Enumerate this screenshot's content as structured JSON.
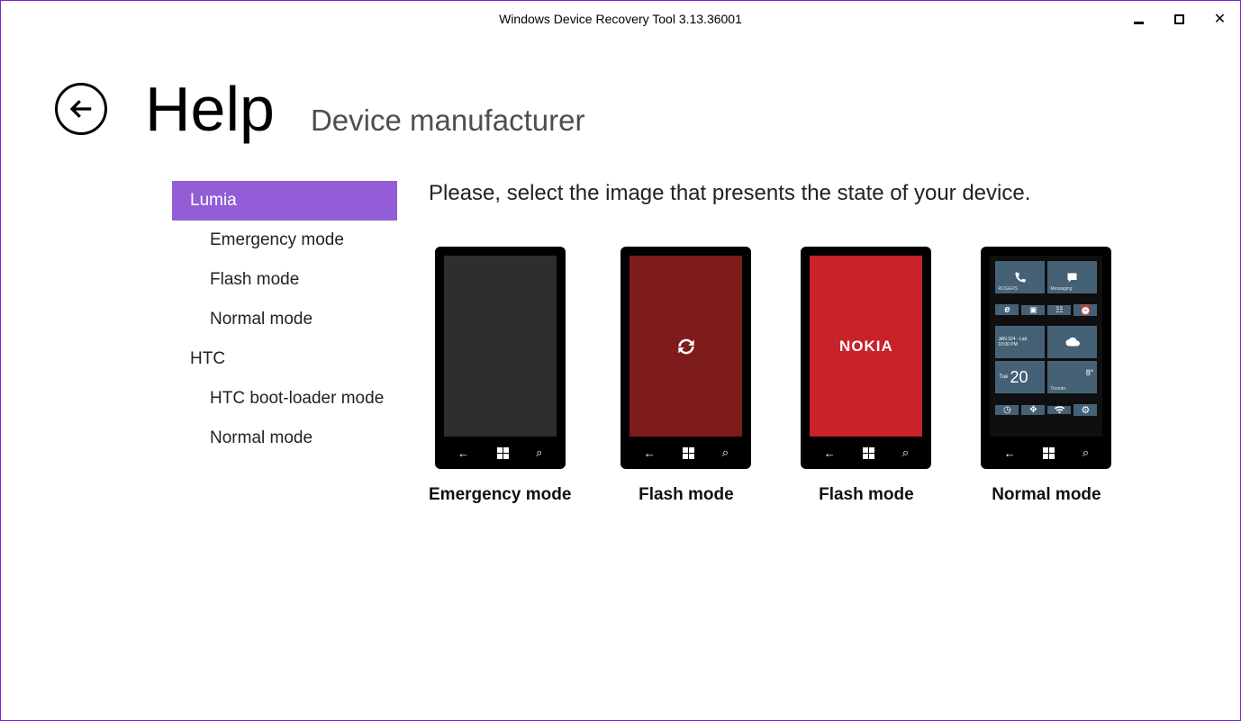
{
  "window": {
    "title": "Windows Device Recovery Tool 3.13.36001"
  },
  "header": {
    "title": "Help",
    "subtitle": "Device manufacturer"
  },
  "sidebar": {
    "items": [
      {
        "label": "Lumia",
        "selected": true,
        "sub": false
      },
      {
        "label": "Emergency mode",
        "selected": false,
        "sub": true
      },
      {
        "label": "Flash mode",
        "selected": false,
        "sub": true
      },
      {
        "label": "Normal mode",
        "selected": false,
        "sub": true
      },
      {
        "label": "HTC",
        "selected": false,
        "sub": false
      },
      {
        "label": "HTC boot-loader mode",
        "selected": false,
        "sub": true
      },
      {
        "label": "Normal mode",
        "selected": false,
        "sub": true
      }
    ]
  },
  "main": {
    "instruction": "Please, select the image that presents the state of your device.",
    "devices": [
      {
        "label": "Emergency mode",
        "screen_type": "dark"
      },
      {
        "label": "Flash mode",
        "screen_type": "red-dark"
      },
      {
        "label": "Flash mode",
        "screen_type": "red-nokia",
        "brand": "NOKIA"
      },
      {
        "label": "Normal mode",
        "screen_type": "tiles"
      }
    ]
  },
  "tiles": {
    "row1_left_label": "ROGERS",
    "row1_right_label": "Messaging",
    "row3_left_top": "JAN 324 - Lab",
    "row3_left_bottom": "10:00 PM",
    "row4_left_day": "Tue",
    "row4_left_num": "20",
    "row4_right_label": "Toronto",
    "row4_right_temp": "8°"
  }
}
